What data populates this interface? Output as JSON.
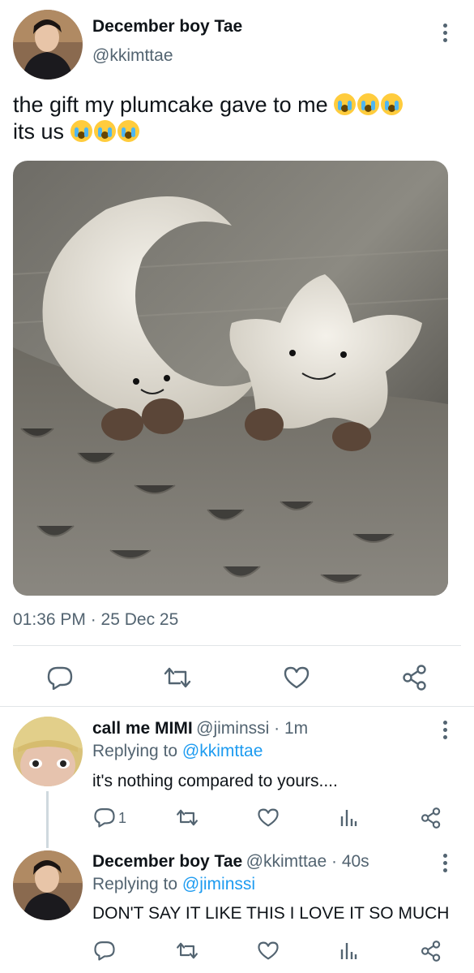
{
  "main_tweet": {
    "author_name": "December boy Tae",
    "author_handle": "@kkimttae",
    "text_line1": "the gift my plumcake gave to me",
    "text_line2": "its us",
    "emoji": "loudly-crying-face",
    "timestamp": "01:36 PM · 25 Dec 25",
    "actions": [
      "reply-icon",
      "retweet-icon",
      "like-icon",
      "share-icon"
    ]
  },
  "replies": [
    {
      "author_name": "call me MIMI",
      "author_handle": "@jiminssi",
      "time": " · 1m",
      "replying_prefix": "Replying to ",
      "replying_to": "@kkimttae",
      "text": "it's nothing compared to yours....",
      "reply_count": "1"
    },
    {
      "author_name": "December boy Tae",
      "author_handle": "@kkimttae",
      "time": " · 40s",
      "replying_prefix": "Replying to ",
      "replying_to": "@jiminssi",
      "text": "DON'T SAY IT LIKE THIS I LOVE IT SO MUCH"
    }
  ],
  "colors": {
    "text": "#0f1419",
    "secondary": "#536471",
    "link": "#1d9bf0",
    "divider": "#e1e5e8"
  }
}
